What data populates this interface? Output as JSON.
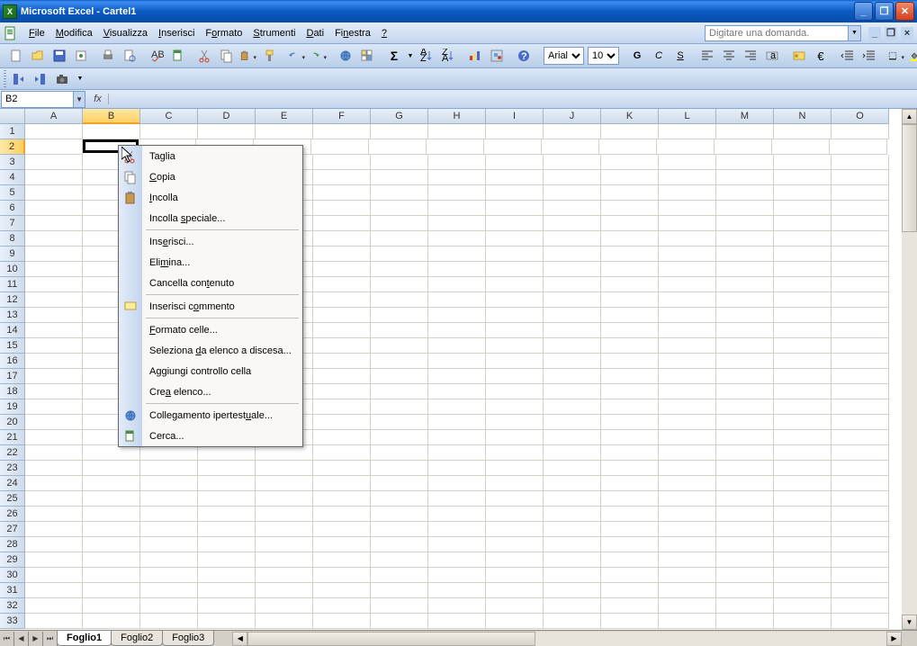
{
  "titlebar": {
    "title": "Microsoft Excel - Cartel1"
  },
  "menus": {
    "file": "File",
    "edit": "Modifica",
    "view": "Visualizza",
    "insert": "Inserisci",
    "format": "Formato",
    "tools": "Strumenti",
    "data": "Dati",
    "window": "Finestra",
    "help": "?"
  },
  "help_placeholder": "Digitare una domanda.",
  "font": {
    "name": "Arial",
    "size": "10"
  },
  "name_box": "B2",
  "columns": [
    "A",
    "B",
    "C",
    "D",
    "E",
    "F",
    "G",
    "H",
    "I",
    "J",
    "K",
    "L",
    "M",
    "N",
    "O"
  ],
  "rows": [
    "1",
    "2",
    "3",
    "4",
    "5",
    "6",
    "7",
    "8",
    "9",
    "10",
    "11",
    "12",
    "13",
    "14",
    "15",
    "16",
    "17",
    "18",
    "19",
    "20",
    "21",
    "22",
    "23",
    "24",
    "25",
    "26",
    "27",
    "28",
    "29",
    "30",
    "31",
    "32",
    "33"
  ],
  "selected_col": "B",
  "selected_row": "2",
  "context_menu": {
    "cut": "Taglia",
    "copy": "Copia",
    "paste": "Incolla",
    "paste_special": "Incolla speciale...",
    "insert": "Inserisci...",
    "delete": "Elimina...",
    "clear": "Cancella contenuto",
    "insert_comment": "Inserisci commento",
    "format_cells": "Formato celle...",
    "pick_list": "Seleziona da elenco a discesa...",
    "add_watch": "Aggiungi controllo cella",
    "create_list": "Crea elenco...",
    "hyperlink": "Collegamento ipertestuale...",
    "lookup": "Cerca..."
  },
  "sheets": {
    "s1": "Foglio1",
    "s2": "Foglio2",
    "s3": "Foglio3"
  },
  "fx": "fx",
  "style_buttons": {
    "bold": "G",
    "italic": "C",
    "underline": "S"
  },
  "currency": "€"
}
